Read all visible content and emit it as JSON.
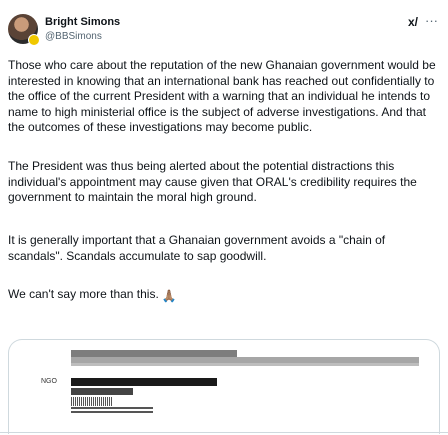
{
  "author": {
    "name": "Bright Simons",
    "handle": "@BBSimons",
    "grok_icon": "grok-icon",
    "more_icon": "more-options-icon"
  },
  "post": {
    "paragraphs": [
      "Those who care about the reputation of the new Ghanaian government would be interested in knowing that an international bank has reached out confidentially to the office of the current President with a warning that an individual he intends to name to high ministerial office is the subject of adverse investigations. And that the outcomes of these investigations may become public.",
      "The President was thus being alerted about the potential distractions this individual's appointment may cause given that ORAL's credibility requires the government to maintain the moral high ground.",
      "It is generally important that a Ghanaian government avoids a \"chain of scandals\". Scandals accumulate to sap goodwill.",
      "We can't say more than this."
    ],
    "emoji": "🙏🏽"
  },
  "media": {
    "label": "NGO"
  },
  "colors": {
    "text": "#0f1419",
    "secondary": "#536471",
    "border": "#cfd9de"
  }
}
